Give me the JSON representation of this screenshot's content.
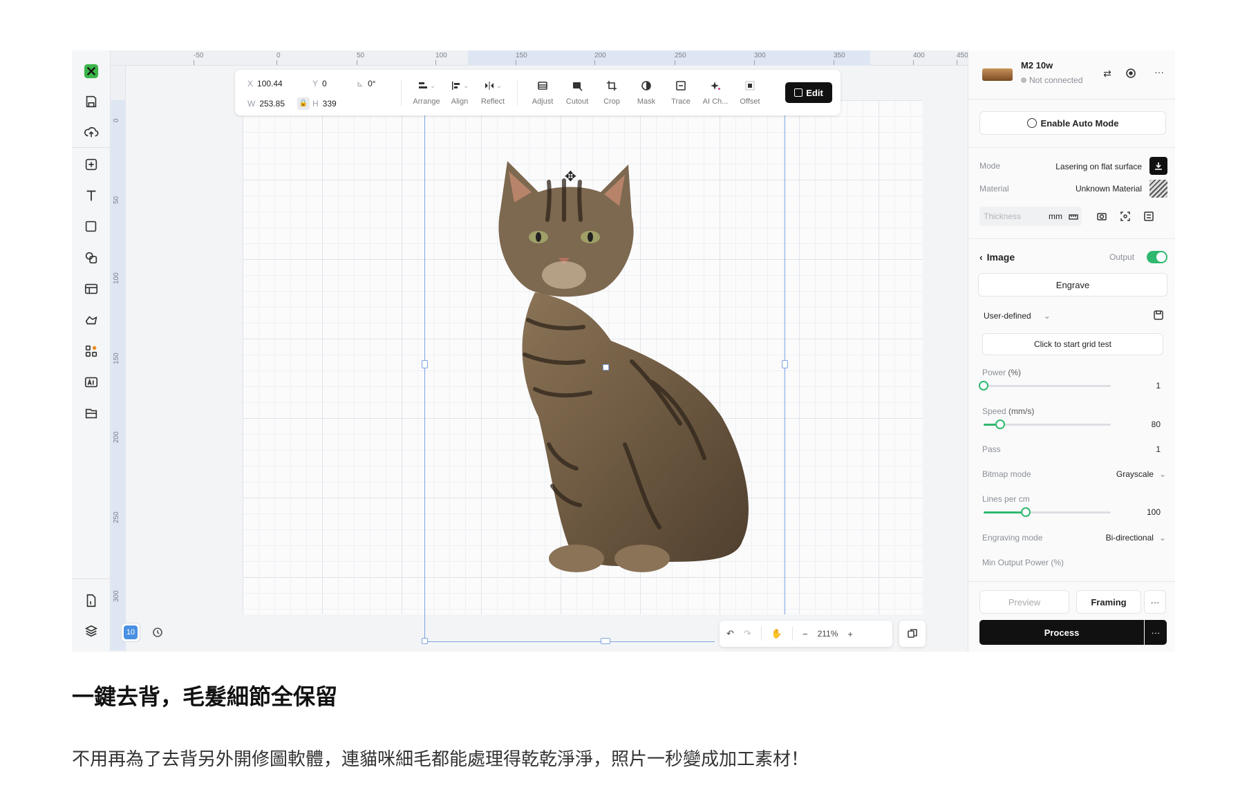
{
  "ruler": {
    "top_ticks": [
      "-50",
      "0",
      "50",
      "100",
      "150",
      "200",
      "250",
      "300",
      "350",
      "400",
      "450"
    ],
    "left_ticks": [
      "0",
      "50",
      "100",
      "150",
      "200",
      "250",
      "300"
    ]
  },
  "property_toolbar": {
    "x_label": "X",
    "x_value": "100.44",
    "y_label": "Y",
    "y_value": "0",
    "w_label": "W",
    "w_value": "253.85",
    "h_label": "H",
    "h_value": "339",
    "rotation": "0°",
    "tools": [
      "Arrange",
      "Align",
      "Reflect",
      "Adjust",
      "Cutout",
      "Crop",
      "Mask",
      "Trace",
      "AI Ch...",
      "Offset"
    ],
    "edit_label": "Edit"
  },
  "canvas": {
    "layer_count": "10",
    "zoom": "211%"
  },
  "device": {
    "name": "M2 10w",
    "status": "Not connected",
    "auto_mode_label": "Enable Auto Mode"
  },
  "settings": {
    "mode_label": "Mode",
    "mode_value": "Lasering on flat surface",
    "material_label": "Material",
    "material_value": "Unknown Material",
    "thickness_placeholder": "Thickness",
    "thickness_unit": "mm"
  },
  "image_panel": {
    "title": "Image",
    "output_label": "Output",
    "output_on": true,
    "process_type": "Engrave",
    "preset": "User-defined",
    "grid_test_label": "Click to start grid test",
    "power_label": "Power",
    "power_unit": "(%)",
    "power_value": "1",
    "speed_label": "Speed",
    "speed_unit": "(mm/s)",
    "speed_value": "80",
    "pass_label": "Pass",
    "pass_value": "1",
    "bitmap_label": "Bitmap mode",
    "bitmap_value": "Grayscale",
    "lines_label": "Lines per cm",
    "lines_value": "100",
    "engraving_label": "Engraving mode",
    "engraving_value": "Bi-directional",
    "min_power_label": "Min Output Power (%)",
    "slider_fractions": {
      "power": 0.0,
      "speed": 0.13,
      "lines": 0.33
    }
  },
  "footer": {
    "preview_label": "Preview",
    "framing_label": "Framing",
    "process_label": "Process",
    "more_label": "···"
  },
  "caption": {
    "heading": "一鍵去背，毛髮細節全保留",
    "body": "不用再為了去背另外開修圖軟體，連貓咪細毛都能處理得乾乾淨淨，照片一秒變成加工素材！"
  },
  "colors": {
    "accent_green": "#2fb86e",
    "logo_green": "#3bb54a",
    "selection_blue": "#7ea4e0"
  }
}
